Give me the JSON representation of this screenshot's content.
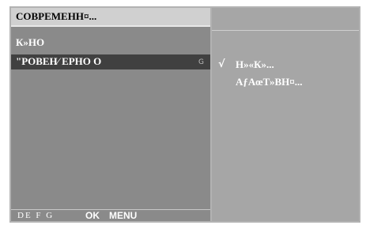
{
  "menu": {
    "title": "СОВРЕМЕНН¤...",
    "items": [
      {
        "label": "К»НО"
      },
      {
        "label": "\"РОВЕН⁄    ЕРНО  О",
        "arrow": "G"
      }
    ],
    "footer": {
      "glyphs": "DE  F G",
      "ok": "OK",
      "menu": "MENU"
    }
  },
  "options": {
    "check": "√",
    "items": [
      {
        "label": "Н»«К»..."
      },
      {
        "label": "АƒАœТ»ВН¤..."
      }
    ]
  }
}
